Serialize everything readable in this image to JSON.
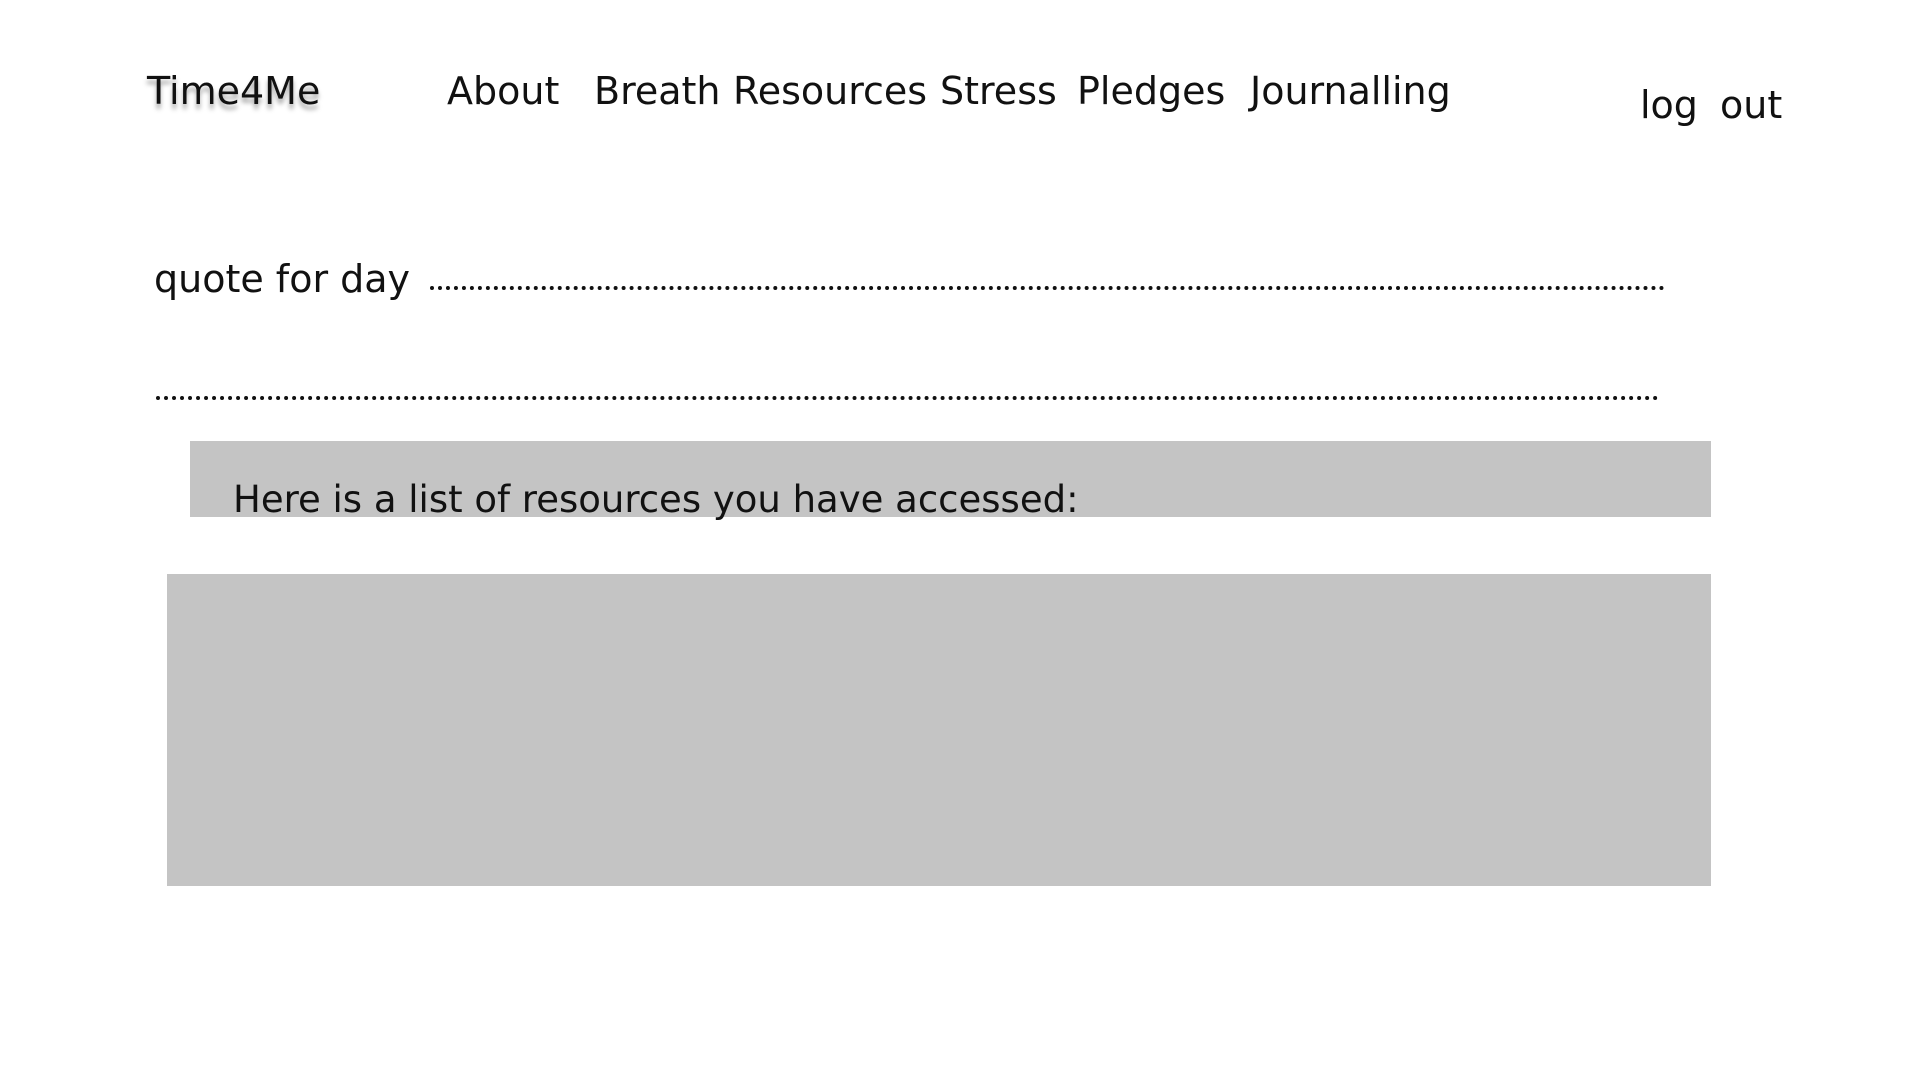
{
  "header": {
    "brand": "Time4Me",
    "nav": [
      {
        "label": "About"
      },
      {
        "label": "Breath"
      },
      {
        "label": "Resources"
      },
      {
        "label": "Stress"
      },
      {
        "label": "Pledges"
      },
      {
        "label": "Journalling"
      }
    ],
    "logout_label": "log  out"
  },
  "quote": {
    "label": "quote for day"
  },
  "resources": {
    "heading": "Here is a list of resources you have accessed:",
    "items": []
  },
  "colors": {
    "panel": "#c4c4c4",
    "text": "#111111",
    "background": "#ffffff"
  }
}
